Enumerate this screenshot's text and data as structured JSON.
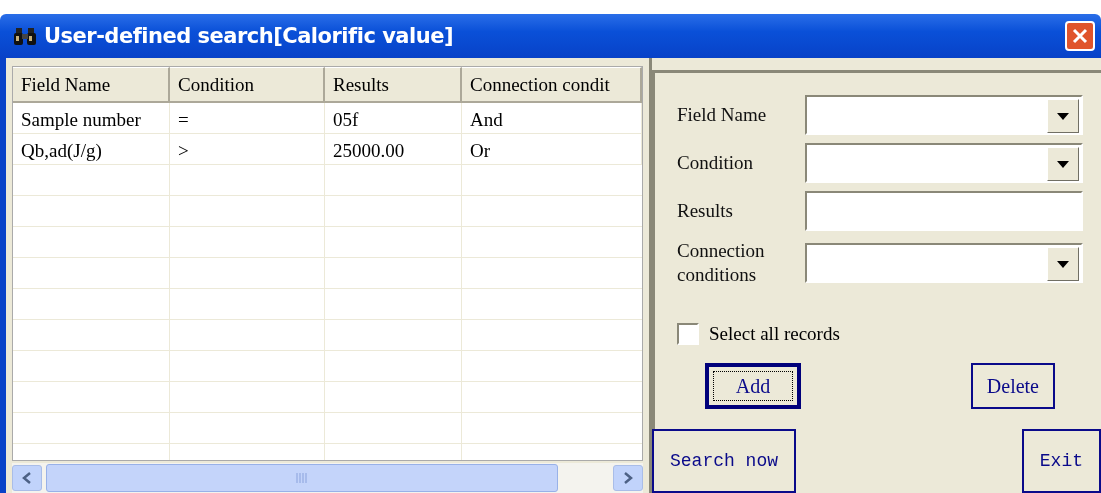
{
  "window": {
    "title": "User-defined search[Calorific value]"
  },
  "table": {
    "columns": [
      "Field Name",
      "Condition",
      "Results",
      "Connection condit"
    ],
    "rows": [
      [
        "Sample number",
        "=",
        "05f",
        "And"
      ],
      [
        "Qb,ad(J/g)",
        ">",
        "25000.00",
        "Or"
      ]
    ]
  },
  "form": {
    "fields": [
      {
        "label": "Field Name",
        "kind": "combo"
      },
      {
        "label": "Condition",
        "kind": "combo"
      },
      {
        "label": "Results",
        "kind": "text"
      },
      {
        "label": "Connection conditions",
        "kind": "combo"
      }
    ],
    "select_all": {
      "label": "Select all records",
      "checked": false
    },
    "buttons": [
      {
        "label": "Add",
        "focused": true
      },
      {
        "label": "Delete",
        "focused": false
      }
    ]
  },
  "bottom_buttons": [
    "Search now",
    "Exit"
  ]
}
